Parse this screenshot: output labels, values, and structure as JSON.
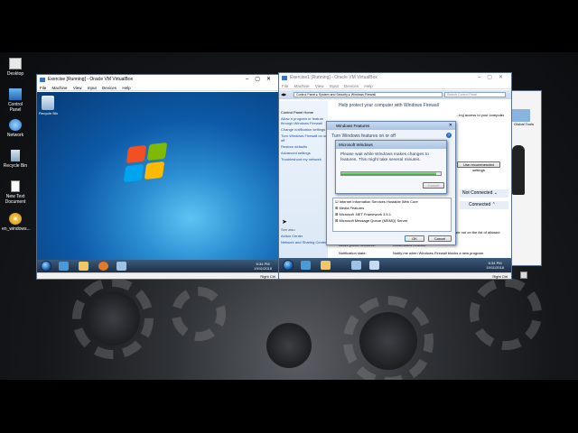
{
  "desktop_icons": [
    {
      "label": "Desktop",
      "icon": "desktop-icon"
    },
    {
      "label": "Control Panel",
      "icon": "control-panel-icon"
    },
    {
      "label": "Network",
      "icon": "network-icon"
    },
    {
      "label": "Recycle Bin",
      "icon": "recycle-bin-icon"
    },
    {
      "label": "New Text Document",
      "icon": "text-document-icon"
    },
    {
      "label": "en_windows...",
      "icon": "disc-image-icon"
    }
  ],
  "vm1": {
    "title": "Exercise [Running] - Oracle VM VirtualBox",
    "menu": [
      "File",
      "Machine",
      "View",
      "Input",
      "Devices",
      "Help"
    ],
    "recycle_label": "Recycle Bin",
    "clock_time": "6:34 PM",
    "clock_date": "19/11/2018",
    "status": "Right Ctrl"
  },
  "vm2": {
    "title": "Exercise1 [Running] - Oracle VM VirtualBox",
    "menu": [
      "File",
      "Machine",
      "View",
      "Input",
      "Devices",
      "Help"
    ],
    "breadcrumb": [
      "Control Panel",
      "System and Security",
      "Windows Firewall"
    ],
    "search_placeholder": "Search Control Panel",
    "sidebar": [
      "Control Panel Home",
      "Allow a program or feature through Windows Firewall",
      "Change notification settings",
      "Turn Windows Firewall on or off",
      "Restore defaults",
      "Advanced settings",
      "Troubleshoot my network"
    ],
    "see_also": "See also",
    "see_also_links": [
      "Action Center",
      "Network and Sharing Center"
    ],
    "heading": "Help protect your computer with Windows Firewall",
    "heading_tail": "...ing access to your computer",
    "recommended_button": "Use recommended settings",
    "not_connected": "Not Connected",
    "connected": "Connected",
    "rows": [
      {
        "k": "Incoming connections:",
        "v": "Block all connections to programs that are not on the list of allowed programs"
      },
      {
        "k": "Active public networks:",
        "v": "Unidentified network"
      },
      {
        "k": "Notification state:",
        "v": "Notify me when Windows Firewall blocks a new program"
      }
    ],
    "clock_time": "6:34 PM",
    "clock_date": "19/11/2018",
    "status": "Right Ctrl"
  },
  "features_dialog": {
    "title": "Windows Features",
    "header": "Turn Windows features on or off",
    "features": [
      "Internet Information Services Hostable Web Core",
      "Media Features",
      "Microsoft .NET Framework 3.5.1",
      "Microsoft Message Queue (MSMQ) Server"
    ],
    "ok": "OK",
    "cancel": "Cancel"
  },
  "progress_dialog": {
    "title": "Microsoft Windows",
    "message": "Please wait while Windows makes changes to features. This might take several minutes.",
    "progress": 0.95,
    "cancel": "Cancel"
  },
  "right_window": {
    "label": "Global Tools"
  }
}
